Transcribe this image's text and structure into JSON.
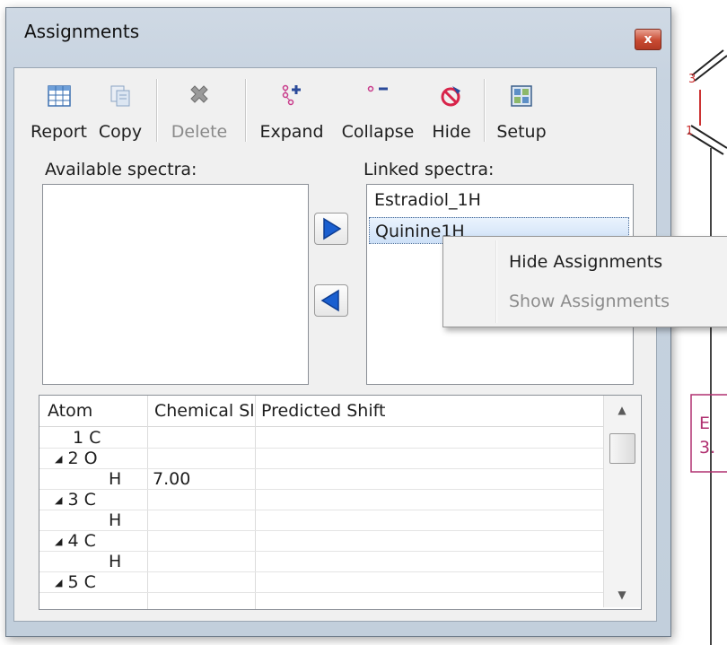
{
  "dialog": {
    "title": "Assignments",
    "close_glyph": "x"
  },
  "toolbar": {
    "buttons": [
      {
        "label": "Report",
        "icon": "table-icon",
        "enabled": true
      },
      {
        "label": "Copy",
        "icon": "copy-icon",
        "enabled": true
      },
      {
        "label": "Delete",
        "icon": "delete-x-icon",
        "enabled": false
      },
      {
        "label": "Expand",
        "icon": "expand-tree-icon",
        "enabled": true
      },
      {
        "label": "Collapse",
        "icon": "collapse-tree-icon",
        "enabled": true
      },
      {
        "label": "Hide",
        "icon": "hide-icon",
        "enabled": true
      },
      {
        "label": "Setup",
        "icon": "setup-icon",
        "enabled": true
      }
    ]
  },
  "spectra": {
    "available_label": "Available spectra:",
    "linked_label": "Linked spectra:",
    "available_items": [],
    "linked_items": [
      {
        "name": "Estradiol_1H",
        "selected": false
      },
      {
        "name": "Quinine1H",
        "selected": true
      }
    ],
    "move_right_icon": "arrow-right-icon",
    "move_left_icon": "arrow-left-icon"
  },
  "grid": {
    "columns": [
      "Atom",
      "Chemical Sl",
      "Predicted Shift"
    ],
    "rows": [
      {
        "atom": "1 C",
        "expander": false,
        "child": false,
        "shift": ""
      },
      {
        "atom": "2 O",
        "expander": true,
        "child": false,
        "shift": ""
      },
      {
        "atom": "H",
        "expander": false,
        "child": true,
        "shift": "7.00"
      },
      {
        "atom": "3 C",
        "expander": true,
        "child": false,
        "shift": ""
      },
      {
        "atom": "H",
        "expander": false,
        "child": true,
        "shift": ""
      },
      {
        "atom": "4 C",
        "expander": true,
        "child": false,
        "shift": ""
      },
      {
        "atom": "H",
        "expander": false,
        "child": true,
        "shift": ""
      },
      {
        "atom": "5 C",
        "expander": true,
        "child": false,
        "shift": ""
      }
    ],
    "expander_glyph": "◢"
  },
  "context_menu": {
    "items": [
      {
        "label": "Hide Assignments",
        "enabled": true
      },
      {
        "label": "Show Assignments",
        "enabled": false
      }
    ]
  },
  "background": {
    "labels": [
      "3",
      "1",
      "E",
      "3."
    ],
    "accent_color": "#b03070",
    "line_color": "#d04040"
  },
  "colors": {
    "dialog_frame": "#c7d3e0",
    "client": "#f0f0f0",
    "selection": "#cde0f7",
    "close_button": "#c84a32",
    "arrow_blue": "#1a5fd0"
  }
}
